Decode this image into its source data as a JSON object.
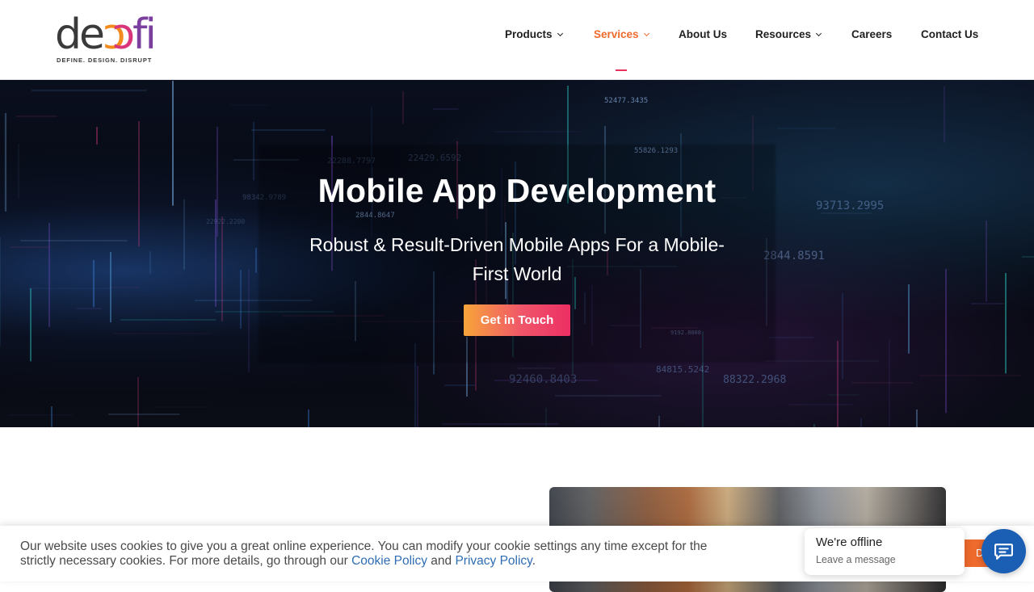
{
  "brand": {
    "logo_parts": [
      "de",
      "ɔ",
      "ɔ",
      "fi"
    ],
    "tagline": "DEFINE. DESIGN. DISRUPT",
    "colors": {
      "accent": "#ee6a2d",
      "pink": "#e8315c",
      "link": "#2f6db4",
      "chat": "#1a5fb4"
    }
  },
  "nav": {
    "items": [
      {
        "label": "Products",
        "has_dropdown": true
      },
      {
        "label": "Services",
        "has_dropdown": true,
        "active": true
      },
      {
        "label": "About Us",
        "has_dropdown": false
      },
      {
        "label": "Resources",
        "has_dropdown": true
      },
      {
        "label": "Careers",
        "has_dropdown": false
      },
      {
        "label": "Contact Us",
        "has_dropdown": false
      }
    ]
  },
  "hero": {
    "title": "Mobile App Development",
    "subtitle": "Robust & Result-Driven Mobile Apps For a Mobile-First World",
    "cta_label": "Get in Touch",
    "bg_numbers": [
      "52477.3435",
      "22288.7797",
      "22429.6592",
      "2844.8647",
      "22922.2200",
      "98342.9789",
      "9192.8008",
      "92460.8403",
      "84815.5242",
      "2844.8591",
      "88322.2968",
      "93713.2995",
      "55826.1293"
    ]
  },
  "cookie": {
    "text_before": "Our website uses cookies to give you a great online experience. You can modify your cookie settings any time except for the strictly necessary cookies. For more details, go through our ",
    "cookie_policy": "Cookie Policy",
    "and": " and ",
    "privacy_policy": "Privacy Policy",
    "period": ".",
    "decline_label": "Decl"
  },
  "chat": {
    "title": "We're offline",
    "subtitle": "Leave a message",
    "icon": "chat-bubble-icon"
  }
}
